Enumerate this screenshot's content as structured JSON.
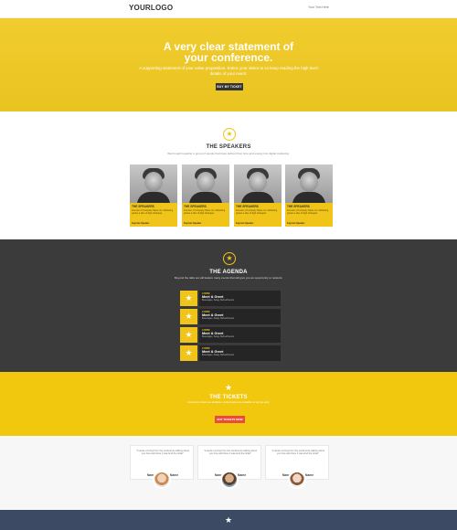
{
  "header": {
    "logo": "YOURLOGO",
    "nav_link": "Your Text Here"
  },
  "hero": {
    "title_line1": "A very clear statement of",
    "title_line2": "your conference.",
    "subtitle": "A supporting statement of your value proposition. Entice your visitor to so keep reading the high level details of your event.",
    "button": "BUY MY TICKET"
  },
  "speakers": {
    "title": "THE SPEAKERS",
    "subtitle": "We brought together a group of people that have defined their time and energy into digital marketing.",
    "cards": [
      {
        "name": "THE SPEAKERS",
        "bio": "Founder of Company Name Inc. Marketing guides a slice of digit strategies.",
        "role": "Keynote Speaker"
      },
      {
        "name": "THE SPEAKERS",
        "bio": "Founder of Company Name Inc. Marketing guides a slice of digit strategies.",
        "role": "Keynote Speaker"
      },
      {
        "name": "THE SPEAKERS",
        "bio": "Founder of Company Name Inc. Marketing guides a slice of digit strategies.",
        "role": "Keynote Speaker"
      },
      {
        "name": "THE SPEAKERS",
        "bio": "Founder of Company Name Inc. Marketing guides a slice of digit strategies.",
        "role": "Keynote Speaker"
      }
    ]
  },
  "agenda": {
    "title": "THE AGENDA",
    "subtitle": "Beyond the talks we will feature many events that will give you an opportunity to network.",
    "items": [
      {
        "time": "4:00PM",
        "event": "Meet & Greet",
        "desc": "Beverages, Swag, Refreshments"
      },
      {
        "time": "4:00PM",
        "event": "Meet & Greet",
        "desc": "Beverages, Swag, Refreshments"
      },
      {
        "time": "4:00PM",
        "event": "Meet & Greet",
        "desc": "Beverages, Swag, Refreshments"
      },
      {
        "time": "4:00PM",
        "event": "Meet & Greet",
        "desc": "Beverages, Swag, Refreshments"
      }
    ]
  },
  "tickets": {
    "title": "THE TICKETS",
    "subtitle": "Conference tickets are available. Limited places are available so sign up early.",
    "button": "BUY TICKETS NOW"
  },
  "testimonials": [
    {
      "quote": "\"A quote coming from the conference talking about you how well done it was kind the ticket\"",
      "name": "Name and Last Name"
    },
    {
      "quote": "\"A quote coming from the conference talking about you how well done it was kind the ticket\"",
      "name": "Name and Last Name"
    },
    {
      "quote": "\"A quote coming from the conference talking about you how well done it was kind the ticket\"",
      "name": "Name and Last Name"
    }
  ],
  "colors": {
    "accent_yellow": "#f0c419",
    "dark_section": "#3b3b3b",
    "ticket_button": "#e74c3c",
    "footer": "#3d4a63"
  },
  "icons": [
    "star-icon"
  ]
}
